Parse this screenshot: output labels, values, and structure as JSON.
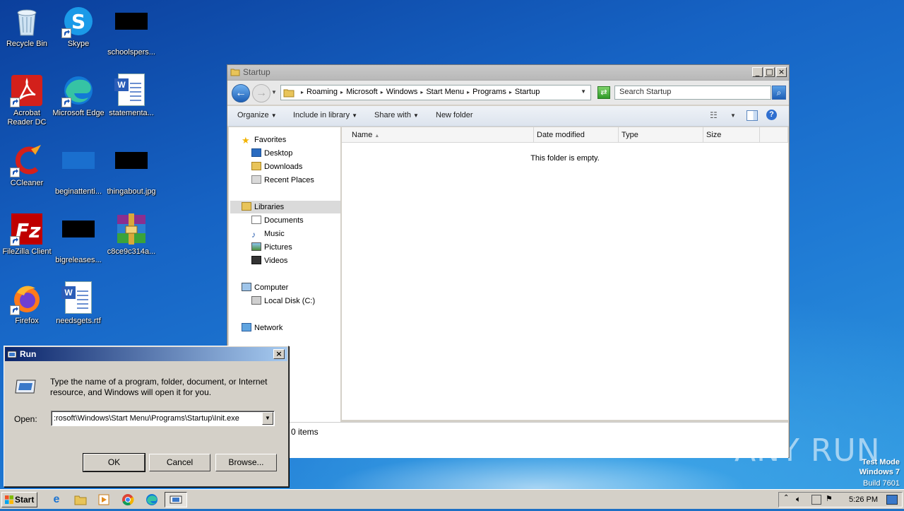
{
  "desktop": {
    "icons": [
      {
        "label": "Recycle Bin",
        "icon": "recycle-bin-icon"
      },
      {
        "label": "Skype",
        "icon": "skype-icon"
      },
      {
        "label": "schoolspers...",
        "icon": "image-file-icon"
      },
      {
        "label": "Acrobat Reader DC",
        "icon": "acrobat-reader-icon"
      },
      {
        "label": "Microsoft Edge",
        "icon": "edge-icon"
      },
      {
        "label": "statementa...",
        "icon": "word-document-icon"
      },
      {
        "label": "CCleaner",
        "icon": "ccleaner-icon"
      },
      {
        "label": "beginattenti...",
        "icon": "file-icon"
      },
      {
        "label": "thingabout.jpg",
        "icon": "image-file-icon"
      },
      {
        "label": "FileZilla Client",
        "icon": "filezilla-icon"
      },
      {
        "label": "bigreleases...",
        "icon": "image-file-icon"
      },
      {
        "label": "c8ce9c314a...",
        "icon": "winrar-archive-icon"
      },
      {
        "label": "Firefox",
        "icon": "firefox-icon"
      },
      {
        "label": "needsgets.rtf",
        "icon": "word-document-icon"
      }
    ]
  },
  "explorer": {
    "title": "Startup",
    "breadcrumbs": [
      "Roaming",
      "Microsoft",
      "Windows",
      "Start Menu",
      "Programs",
      "Startup"
    ],
    "search_placeholder": "Search Startup",
    "toolbar": {
      "organize": "Organize",
      "include_in_library": "Include in library",
      "share_with": "Share with",
      "new_folder": "New folder"
    },
    "nav": {
      "favorites": "Favorites",
      "desktop": "Desktop",
      "downloads": "Downloads",
      "recent_places": "Recent Places",
      "libraries": "Libraries",
      "documents": "Documents",
      "music": "Music",
      "pictures": "Pictures",
      "videos": "Videos",
      "computer": "Computer",
      "local_disk": "Local Disk (C:)",
      "network": "Network"
    },
    "columns": [
      "Name",
      "Date modified",
      "Type",
      "Size"
    ],
    "empty_message": "This folder is empty.",
    "status": "0 items"
  },
  "run_dialog": {
    "title": "Run",
    "description": "Type the name of a program, folder, document, or Internet resource, and Windows will open it for you.",
    "open_label": "Open:",
    "open_value": ":rosoft\\Windows\\Start Menu\\Programs\\Startup\\Init.exe",
    "ok": "OK",
    "cancel": "Cancel",
    "browse": "Browse..."
  },
  "taskbar": {
    "start": "Start",
    "clock": "5:26 PM"
  },
  "watermark": {
    "line1": "Test Mode",
    "line2": "Windows 7",
    "line3": "Build 7601",
    "brand": "ANY RUN"
  }
}
